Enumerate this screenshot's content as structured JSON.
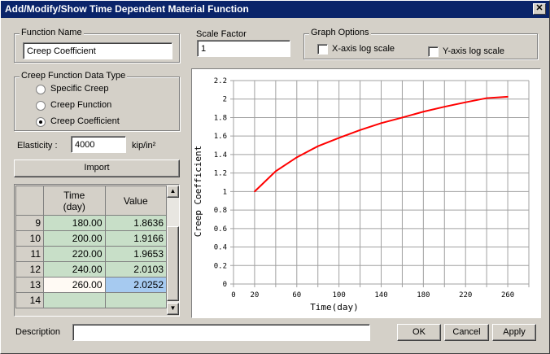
{
  "window": {
    "title": "Add/Modify/Show Time Dependent Material Function",
    "close": "✕"
  },
  "function_name": {
    "label": "Function Name",
    "value": "Creep Coefficient"
  },
  "scale_factor": {
    "label": "Scale Factor",
    "value": "1"
  },
  "graph_options": {
    "label": "Graph Options",
    "x_log": "X-axis log scale",
    "y_log": "Y-axis log scale",
    "x_log_checked": false,
    "y_log_checked": false
  },
  "data_type": {
    "label": "Creep Function Data Type",
    "options": [
      "Specific Creep",
      "Creep Function",
      "Creep Coefficient"
    ],
    "selected": 2
  },
  "elasticity": {
    "label": "Elasticity :",
    "value": "4000",
    "unit": "kip/in²"
  },
  "import_label": "Import",
  "table": {
    "headers": [
      "",
      "Time\n(day)",
      "Value"
    ],
    "rows": [
      {
        "n": "9",
        "time": "180.00",
        "value": "1.8636"
      },
      {
        "n": "10",
        "time": "200.00",
        "value": "1.9166"
      },
      {
        "n": "11",
        "time": "220.00",
        "value": "1.9653"
      },
      {
        "n": "12",
        "time": "240.00",
        "value": "2.0103"
      },
      {
        "n": "13",
        "time": "260.00",
        "value": "2.0252"
      },
      {
        "n": "14",
        "time": "",
        "value": ""
      }
    ]
  },
  "description": {
    "label": "Description",
    "value": ""
  },
  "buttons": {
    "ok": "OK",
    "cancel": "Cancel",
    "apply": "Apply"
  },
  "chart_data": {
    "type": "line",
    "xlabel": "Time(day)",
    "ylabel": "Creep Coefficient",
    "xlim": [
      0,
      280
    ],
    "ylim": [
      0,
      2.2
    ],
    "grid": true,
    "xticks": [
      0,
      20,
      60,
      100,
      140,
      180,
      220,
      260
    ],
    "xgrid": [
      0,
      20,
      40,
      60,
      80,
      100,
      120,
      140,
      160,
      180,
      200,
      220,
      240,
      260,
      280
    ],
    "yticks": [
      0,
      0.2,
      0.4,
      0.6,
      0.8,
      1,
      1.2,
      1.4,
      1.6,
      1.8,
      2,
      2.2
    ],
    "x": [
      20,
      40,
      60,
      80,
      100,
      120,
      140,
      160,
      180,
      200,
      220,
      240,
      260
    ],
    "y": [
      1.0,
      1.22,
      1.37,
      1.49,
      1.58,
      1.665,
      1.74,
      1.8,
      1.8636,
      1.9166,
      1.9653,
      2.0103,
      2.0252
    ],
    "color": "#ff0000"
  }
}
